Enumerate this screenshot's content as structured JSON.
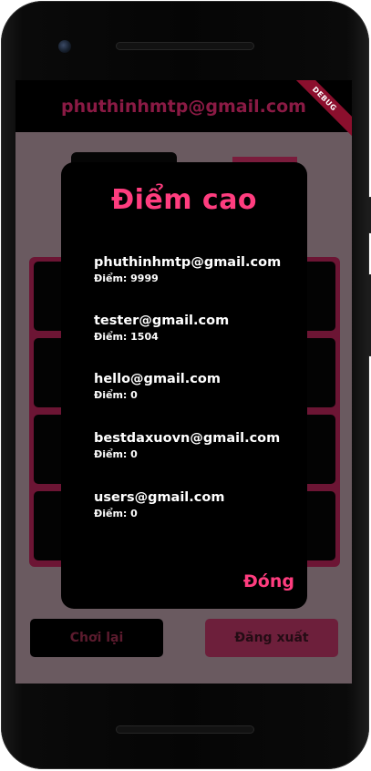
{
  "app": {
    "user_email": "phuthinhmtp@gmail.com",
    "debug_label": "DEBUG"
  },
  "actions": {
    "replay_label": "Chơi lại",
    "logout_label": "Đăng xuất"
  },
  "dialog": {
    "title": "Điểm cao",
    "close_label": "Đóng",
    "entries": [
      {
        "email": "phuthinhmtp@gmail.com",
        "score_text": "Điểm: 9999"
      },
      {
        "email": "tester@gmail.com",
        "score_text": "Điểm: 1504"
      },
      {
        "email": "hello@gmail.com",
        "score_text": "Điểm: 0"
      },
      {
        "email": "bestdaxuovn@gmail.com",
        "score_text": "Điểm: 0"
      },
      {
        "email": "users@gmail.com",
        "score_text": "Điểm: 0"
      }
    ]
  },
  "colors": {
    "accent": "#ff3d7f",
    "appbar_title": "#8a1a44",
    "debug_banner": "#8b0f2d"
  }
}
